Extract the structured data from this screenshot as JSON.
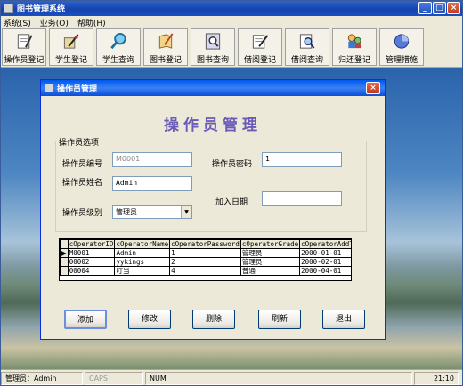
{
  "window": {
    "title": "图书管理系统",
    "min": "_",
    "max": "□",
    "close": "×"
  },
  "menu": [
    "系统(S)",
    "业务(O)",
    "帮助(H)"
  ],
  "toolbar": [
    {
      "label": "操作员登记",
      "icon": "operator-register-icon"
    },
    {
      "label": "学生登记",
      "icon": "student-register-icon"
    },
    {
      "label": "学生查询",
      "icon": "student-search-icon"
    },
    {
      "label": "图书登记",
      "icon": "book-register-icon"
    },
    {
      "label": "图书查询",
      "icon": "book-search-icon"
    },
    {
      "label": "借阅登记",
      "icon": "borrow-register-icon"
    },
    {
      "label": "借阅查询",
      "icon": "borrow-search-icon"
    },
    {
      "label": "归还登记",
      "icon": "return-register-icon"
    },
    {
      "label": "管理措施",
      "icon": "management-icon"
    }
  ],
  "dialog": {
    "title": "操作员管理",
    "heading": "操作员管理",
    "close": "×",
    "group_label": "操作员选项",
    "fields": {
      "id_label": "操作员编号",
      "id_value": "M0001",
      "password_label": "操作员密码",
      "password_value": "1",
      "name_label": "操作员姓名",
      "name_value": "Admin",
      "date_label": "加入日期",
      "date_value": "",
      "grade_label": "操作员级别",
      "grade_value": "管理员"
    },
    "grid": {
      "columns": [
        "cOperatorID",
        "cOperatorName",
        "cOperatorPassword",
        "cOperatorGrade",
        "cOperatorAddTime"
      ],
      "rows": [
        [
          "M0001",
          "Admin",
          "1",
          "管理员",
          "2000-01-01"
        ],
        [
          "00002",
          "yykings",
          "2",
          "管理员",
          "2000-02-01"
        ],
        [
          "00004",
          "叮当",
          "4",
          "普通",
          "2000-04-01"
        ]
      ],
      "current_marker": "▶"
    },
    "buttons": {
      "add": "添加",
      "edit": "修改",
      "delete": "删除",
      "refresh": "刷新",
      "exit": "退出"
    }
  },
  "status": {
    "user": "管理员：Admin",
    "caps": "CAPS",
    "num": "NUM",
    "time": "21:10"
  },
  "colors": {
    "titlebar": "#1443b0",
    "heading": "#6a5aba",
    "face": "#ece9d8"
  }
}
